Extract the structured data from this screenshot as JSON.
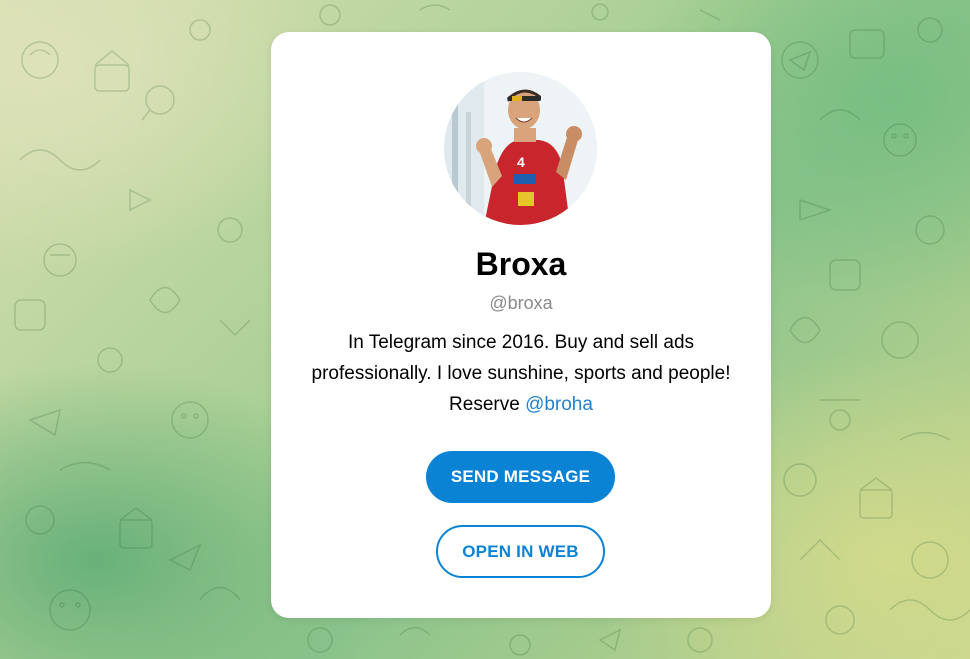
{
  "profile": {
    "name": "Broxa",
    "username": "@broxa",
    "bio_text": "In Telegram since 2016. Buy and sell ads professionally. I love sunshine, sports and people! Reserve ",
    "bio_link": "@broha",
    "avatar_icon": "profile-photo"
  },
  "actions": {
    "send_message_label": "SEND MESSAGE",
    "open_in_web_label": "OPEN IN WEB"
  },
  "colors": {
    "accent": "#0b83d4",
    "link": "#2481cc",
    "muted": "#8a8a8a"
  }
}
